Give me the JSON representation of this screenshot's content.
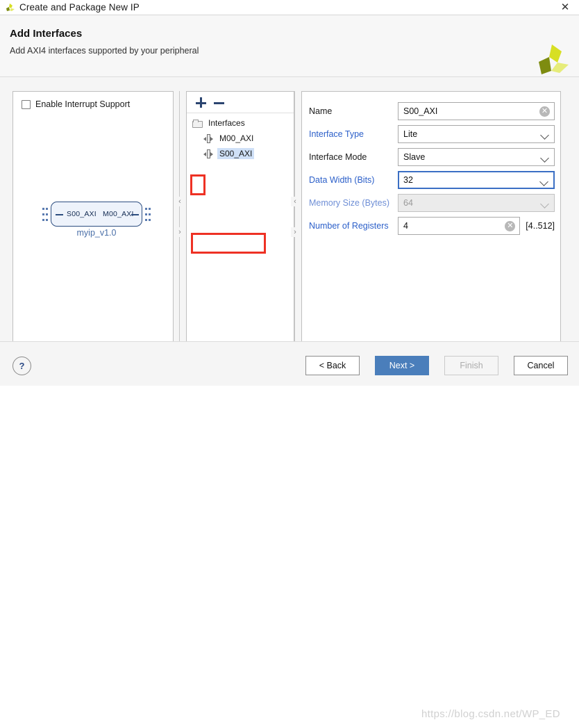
{
  "window": {
    "title": "Create and Package New IP",
    "close_label": "✕",
    "app_icon": "xilinx-vivado-icon"
  },
  "header": {
    "title": "Add Interfaces",
    "subtitle": "Add AXI4 interfaces supported by your peripheral",
    "logo": "xilinx-logo"
  },
  "left_panel": {
    "interrupt_checkbox_label": "Enable Interrupt Support",
    "interrupt_checked": false,
    "diagram": {
      "slave_port": "S00_AXI",
      "master_port": "M00_AXI",
      "module_name": "myip_v1.0"
    }
  },
  "middle_panel": {
    "toolbar": {
      "add_label": "+",
      "remove_label": "−"
    },
    "tree": {
      "root_label": "Interfaces",
      "items": [
        {
          "label": "M00_AXI",
          "selected": false
        },
        {
          "label": "S00_AXI",
          "selected": true
        }
      ]
    }
  },
  "right_panel": {
    "fields": [
      {
        "label": "Name",
        "value": "S00_AXI",
        "type": "text",
        "state": "normal",
        "clearable": true
      },
      {
        "label": "Interface Type",
        "value": "Lite",
        "type": "select",
        "state": "normal",
        "clearable": false
      },
      {
        "label": "Interface Mode",
        "value": "Slave",
        "type": "select",
        "state": "normal",
        "clearable": false
      },
      {
        "label": "Data Width (Bits)",
        "value": "32",
        "type": "select",
        "state": "focused",
        "clearable": false
      },
      {
        "label": "Memory Size (Bytes)",
        "value": "64",
        "type": "select",
        "state": "disabled",
        "clearable": false
      },
      {
        "label": "Number of Registers",
        "value": "4",
        "type": "text",
        "state": "normal",
        "clearable": true,
        "hint": "[4..512]"
      }
    ]
  },
  "splitters": {
    "collapse_left_label": "‹",
    "collapse_right_label": "›"
  },
  "footer": {
    "help_label": "?",
    "back_label": "< Back",
    "back_underline": "B",
    "next_label": "Next >",
    "next_underline": "N",
    "finish_label": "Finish",
    "finish_disabled": true,
    "cancel_label": "Cancel"
  },
  "watermark": "https://blog.csdn.net/WP_ED",
  "colors": {
    "primary_button": "#4a7ebb",
    "link_label": "#2b5fc9",
    "focus_border": "#3b6fc4",
    "annotation": "#ee3124",
    "diagram_border": "#2d4e80",
    "diagram_fill": "#eef3fb",
    "selection": "#cfe0f7"
  }
}
